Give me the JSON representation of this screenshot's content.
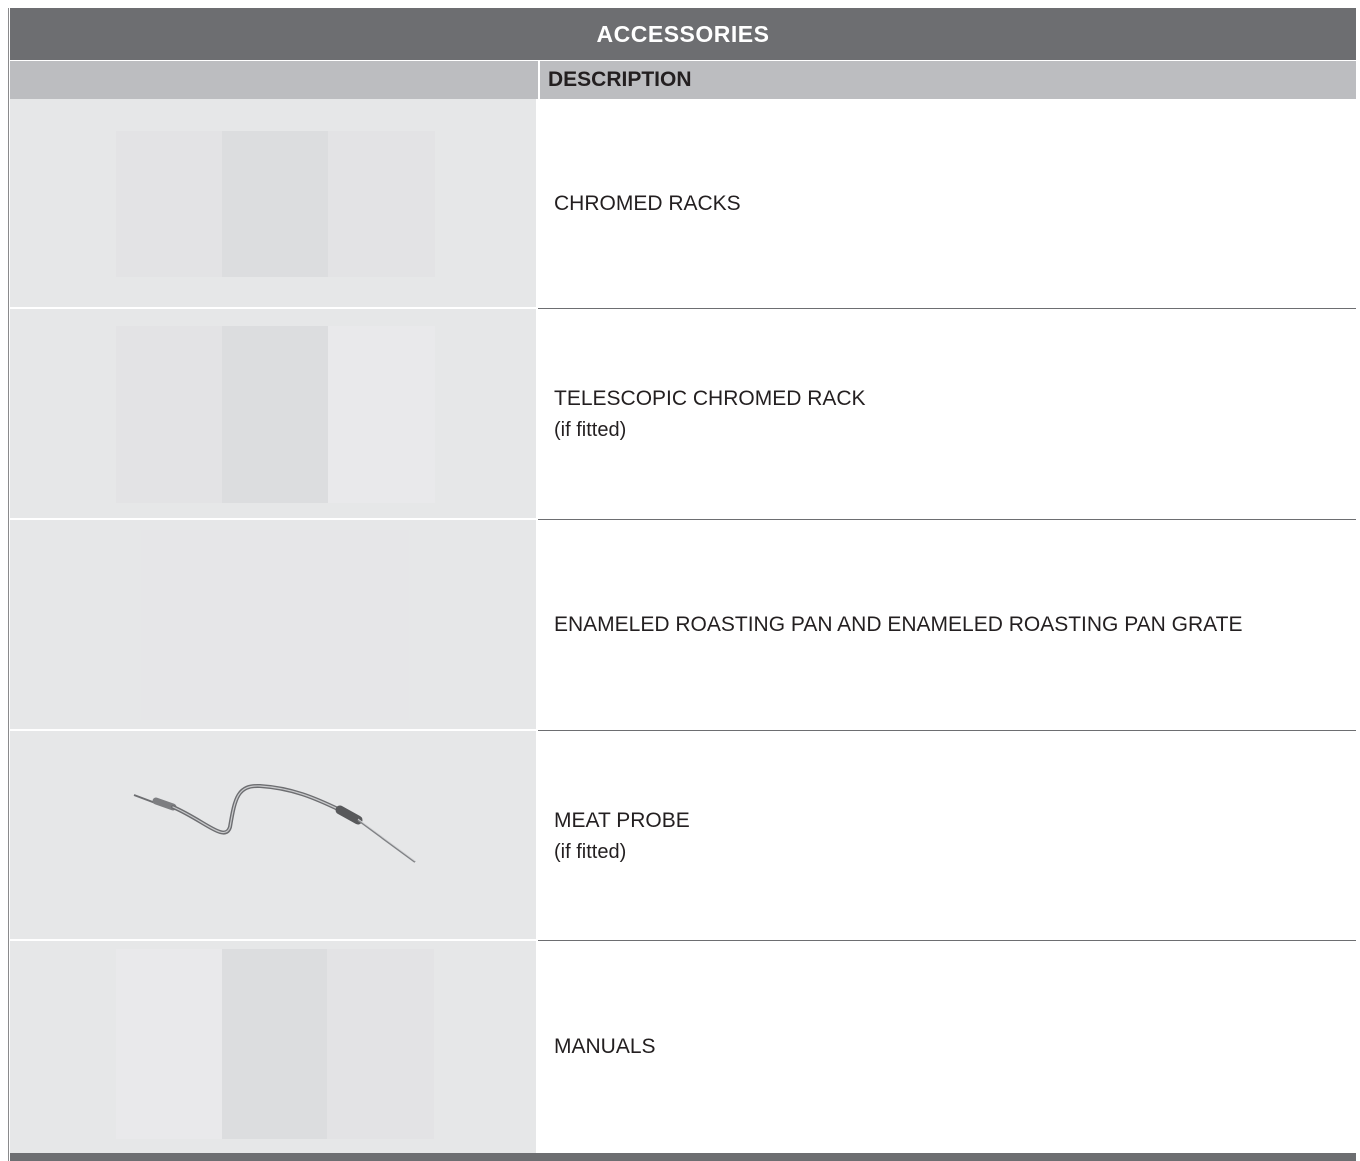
{
  "title": "ACCESSORIES",
  "header": {
    "description_label": "DESCRIPTION"
  },
  "rows": [
    {
      "name": "CHROMED RACKS",
      "note": "",
      "image": "chromed-racks-image"
    },
    {
      "name": "TELESCOPIC CHROMED RACK",
      "note": "(if fitted)",
      "image": "telescopic-rack-image"
    },
    {
      "name": "ENAMELED ROASTING PAN AND ENAMELED ROASTING PAN GRATE",
      "note": "",
      "image": "roasting-pan-image"
    },
    {
      "name": "MEAT PROBE",
      "note": "(if fitted)",
      "image": "meat-probe-icon"
    },
    {
      "name": "MANUALS",
      "note": "",
      "image": "manuals-image"
    }
  ],
  "colors": {
    "title_bar": "#6d6e71",
    "header_bar": "#bcbdc0",
    "image_cell": "#e6e7e8",
    "text": "#231f20"
  }
}
